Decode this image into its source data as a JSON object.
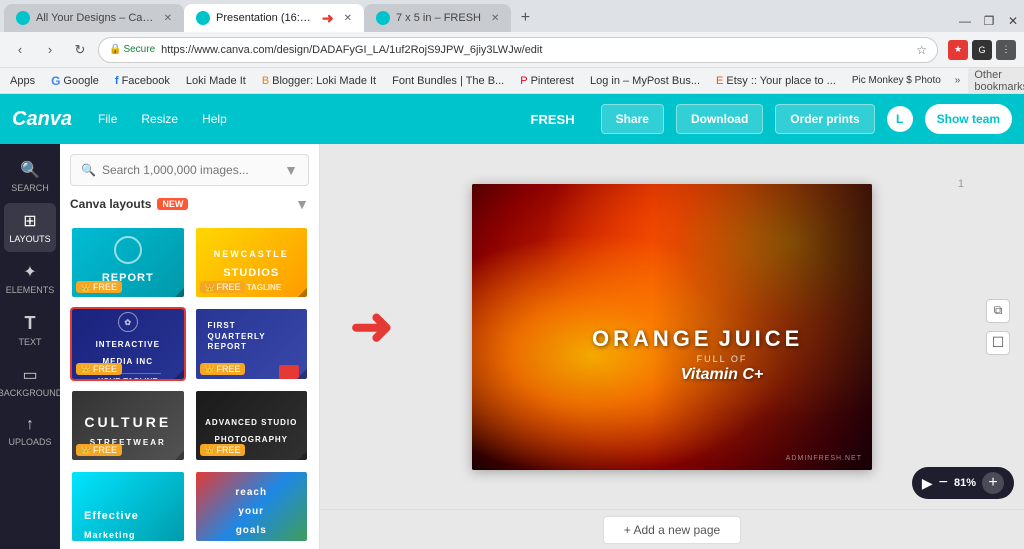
{
  "browser": {
    "tabs": [
      {
        "id": "tab-1",
        "label": "All Your Designs – Canva",
        "active": false,
        "favicon_color": "#00c4cc"
      },
      {
        "id": "tab-2",
        "label": "Presentation (16:9) – ...",
        "active": true,
        "favicon_color": "#00c4cc"
      },
      {
        "id": "tab-3",
        "label": "7 x 5 in – FRESH",
        "active": false,
        "favicon_color": "#00c4cc"
      }
    ],
    "url": {
      "secure_label": "Secure",
      "url_text": "https://www.canva.com/design/DADAFyGI_LA/1uf2RojS9JPW_6jiy3LWJw/edit"
    },
    "bookmarks": [
      {
        "label": "Apps"
      },
      {
        "label": "Google"
      },
      {
        "label": "Facebook"
      },
      {
        "label": "Loki Made It"
      },
      {
        "label": "Blogger: Loki Made It"
      },
      {
        "label": "Font Bundles | The B..."
      },
      {
        "label": "Pinterest"
      },
      {
        "label": "Log in – MyPost Bus..."
      },
      {
        "label": "Etsy :: Your place to ..."
      },
      {
        "label": "PicMonkey's Photo E..."
      }
    ],
    "bookmarks_more": "»",
    "other_bookmarks": "Other bookmarks"
  },
  "canva": {
    "logo": "Canva",
    "menu_items": [
      "File",
      "Resize",
      "Help"
    ],
    "toolbar": {
      "fresh_label": "FRESH",
      "share_label": "Share",
      "download_label": "Download",
      "order_prints_label": "Order prints",
      "show_team_label": "Show team"
    }
  },
  "sidebar_icons": [
    {
      "id": "search",
      "icon": "🔍",
      "label": "SEARCH"
    },
    {
      "id": "layouts",
      "icon": "⊞",
      "label": "LAYOUTS",
      "active": true
    },
    {
      "id": "elements",
      "icon": "✦",
      "label": "ELEMENTS"
    },
    {
      "id": "text",
      "icon": "T",
      "label": "TEXT"
    },
    {
      "id": "background",
      "icon": "▭",
      "label": "BACKGROUND"
    },
    {
      "id": "uploads",
      "icon": "↑",
      "label": "UPLOADS"
    }
  ],
  "panels": {
    "search_placeholder": "Search 1,000,000 images...",
    "filter_label": "Canva layouts",
    "new_badge": "NEW",
    "templates": [
      {
        "id": "report",
        "type": "report",
        "title": "REPORT",
        "has_corner": true,
        "free": true
      },
      {
        "id": "newcastle",
        "type": "newcastle",
        "title": "NEWCASTLE STUDIOS",
        "has_corner": true,
        "free": true
      },
      {
        "id": "interactive",
        "type": "interactive",
        "title": "INTERACTIVE MEDIA INC",
        "has_corner": true,
        "free": true,
        "selected": true
      },
      {
        "id": "first-quarterly",
        "type": "first-quarterly",
        "title": "FIRST QUARTERLY REPORT",
        "has_corner": true,
        "free": true
      },
      {
        "id": "culture",
        "type": "culture",
        "title": "CULTURE STREETWEAR",
        "has_corner": true,
        "free": true
      },
      {
        "id": "advanced",
        "type": "advanced",
        "title": "ADVANCED STUDIO PHOTOGRAPHY",
        "has_corner": true,
        "free": true
      },
      {
        "id": "effective",
        "type": "effective",
        "title": "Effective Marketing",
        "has_corner": false,
        "free": false
      },
      {
        "id": "reach",
        "type": "reach",
        "title": "reach your goals",
        "has_corner": false,
        "free": false
      }
    ]
  },
  "canvas": {
    "title_main": "ORANGE",
    "title_secondary": "JUICE",
    "subtitle1": "FULL OF",
    "subtitle2": "Vitamin C+",
    "watermark": "ADMINFRESH.NET",
    "page_number": "1",
    "add_page_label": "+ Add a new page",
    "zoom_value": "81%"
  },
  "arrow": "→"
}
